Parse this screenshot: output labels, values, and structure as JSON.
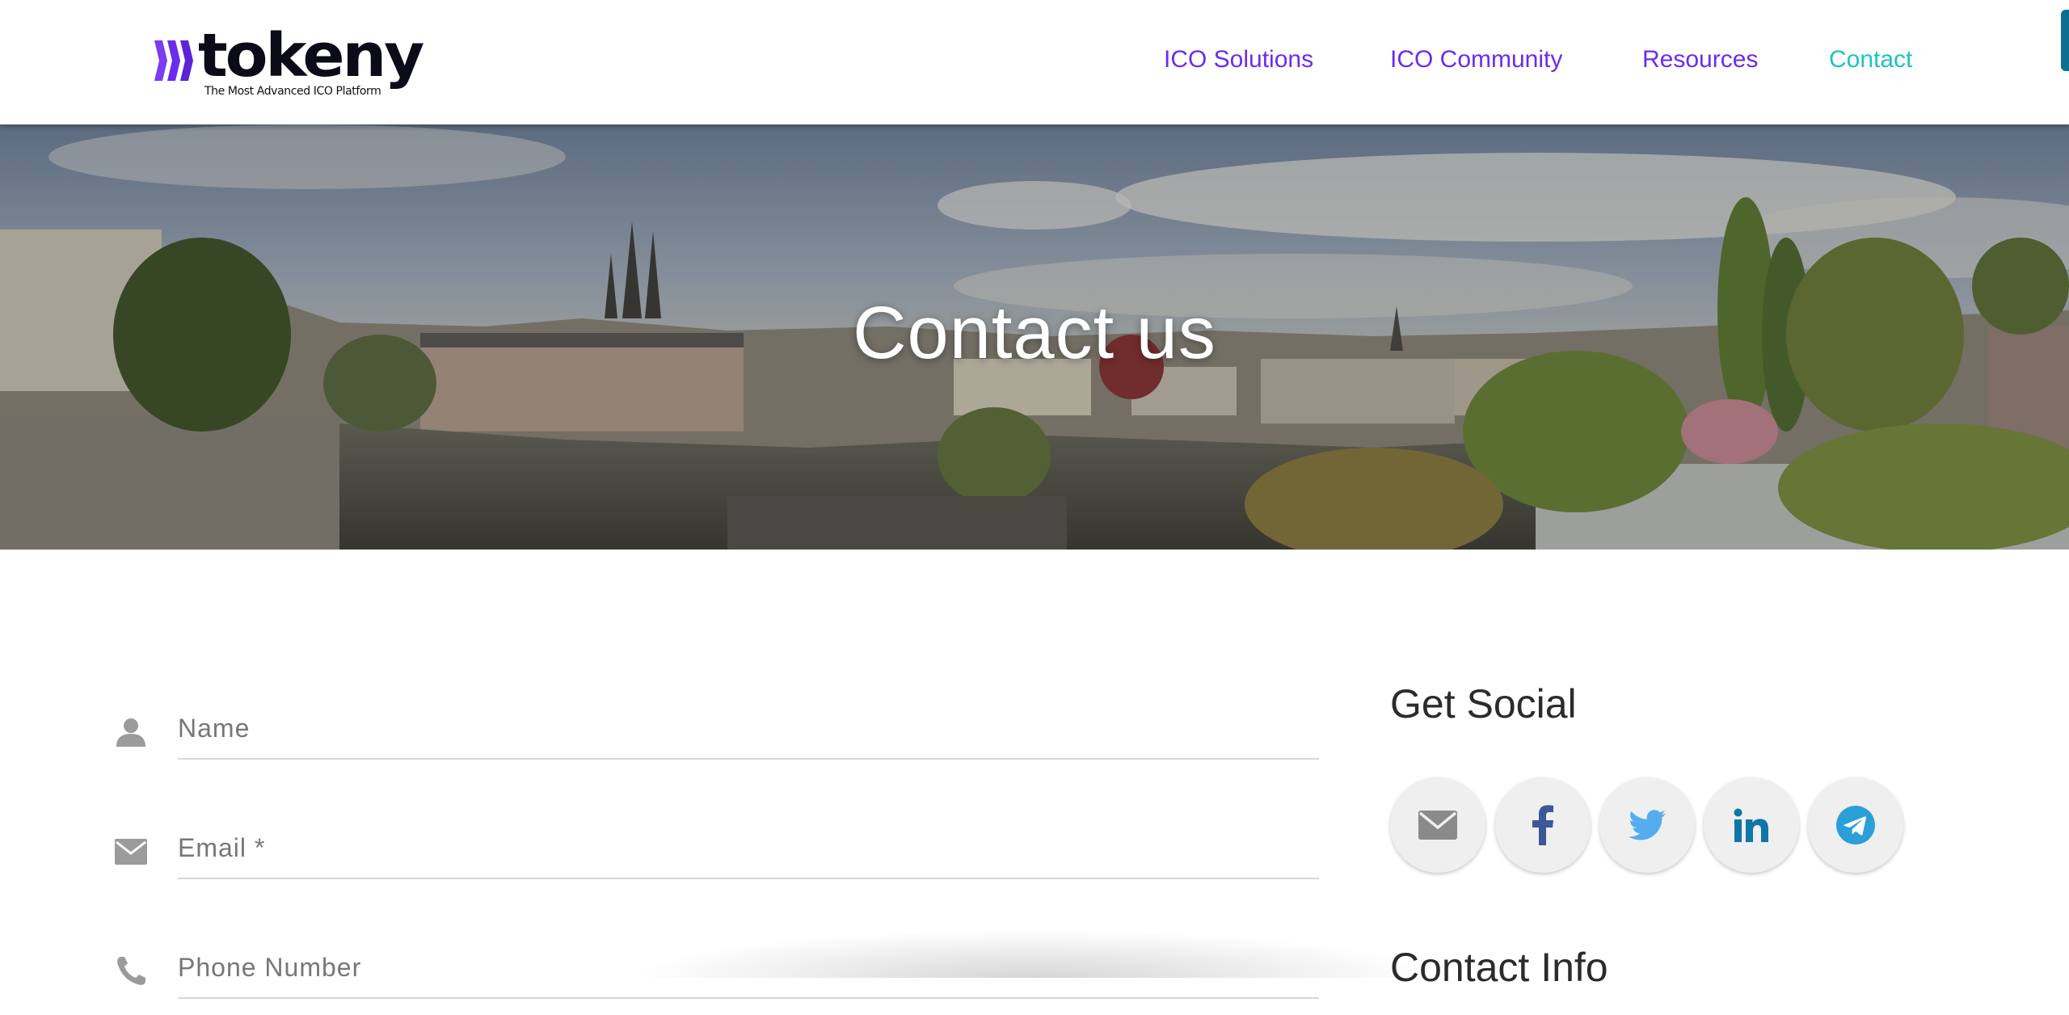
{
  "brand": {
    "name": "tokeny",
    "tagline": "The Most Advanced ICO Platform",
    "primary_color": "#6b2cf0",
    "accent_color": "#1fc2c0"
  },
  "nav": {
    "items": [
      {
        "label": "ICO Solutions",
        "active": false
      },
      {
        "label": "ICO Community",
        "active": false
      },
      {
        "label": "Resources",
        "active": false
      },
      {
        "label": "Contact",
        "active": true
      }
    ]
  },
  "hero": {
    "title": "Contact us",
    "background": "city-panorama-photo"
  },
  "form": {
    "fields": [
      {
        "icon": "person-icon",
        "placeholder": "Name",
        "value": ""
      },
      {
        "icon": "envelope-icon",
        "placeholder": "Email *",
        "value": ""
      },
      {
        "icon": "phone-icon",
        "placeholder": "Phone Number",
        "value": ""
      }
    ]
  },
  "sidebar": {
    "social_heading": "Get Social",
    "social_links": [
      {
        "icon": "mail-icon",
        "color": "#8a8a8a"
      },
      {
        "icon": "facebook-icon",
        "color": "#3b5998"
      },
      {
        "icon": "twitter-icon",
        "color": "#55acee"
      },
      {
        "icon": "linkedin-icon",
        "color": "#0e76a8"
      },
      {
        "icon": "telegram-icon",
        "color": "#2a9fd8"
      }
    ],
    "info_heading": "Contact Info"
  }
}
